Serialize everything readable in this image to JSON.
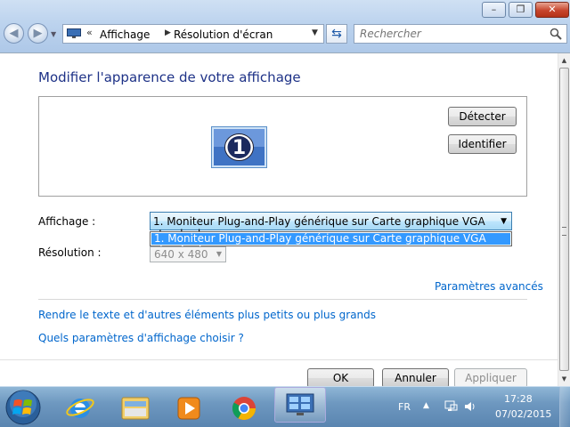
{
  "window": {
    "controls": {
      "minimize": "–",
      "maximize": "❐",
      "close": "✕"
    }
  },
  "nav": {
    "back_icon": "back-arrow-icon",
    "forward_icon": "forward-arrow-icon"
  },
  "address": {
    "chevron": "«",
    "crumbs": [
      "Affichage",
      "Résolution d'écran"
    ],
    "separator": "▶",
    "dropdown": "▼"
  },
  "search": {
    "placeholder": "Rechercher"
  },
  "main": {
    "heading": "Modifier l'apparence de votre affichage",
    "monitor_number": "1",
    "detect_button": "Détecter",
    "identify_button": "Identifier",
    "display_label": "Affichage :",
    "display_value": "1. Moniteur Plug-and-Play générique sur Carte graphique VGA standard",
    "display_options": [
      "1. Moniteur Plug-and-Play générique sur Carte graphique VGA standard"
    ],
    "resolution_label": "Résolution :",
    "resolution_value": "640 x 480",
    "advanced_link": "Paramètres avancés",
    "link_text_size": "Rendre le texte et d'autres éléments plus petits ou plus grands",
    "link_which_settings": "Quels paramètres d'affichage choisir ?"
  },
  "footer": {
    "ok": "OK",
    "cancel": "Annuler",
    "apply": "Appliquer"
  },
  "taskbar": {
    "apps": [
      "start-orb-icon",
      "internet-explorer-icon",
      "windows-explorer-icon",
      "media-player-icon",
      "chrome-icon",
      "display-control-panel-icon"
    ],
    "language": "FR",
    "clock_time": "17:28",
    "clock_date": "07/02/2015"
  },
  "colors": {
    "heading": "#1e3287",
    "link": "#0066cc",
    "selection": "#3399ff",
    "taskbar": "#6e98c0"
  }
}
